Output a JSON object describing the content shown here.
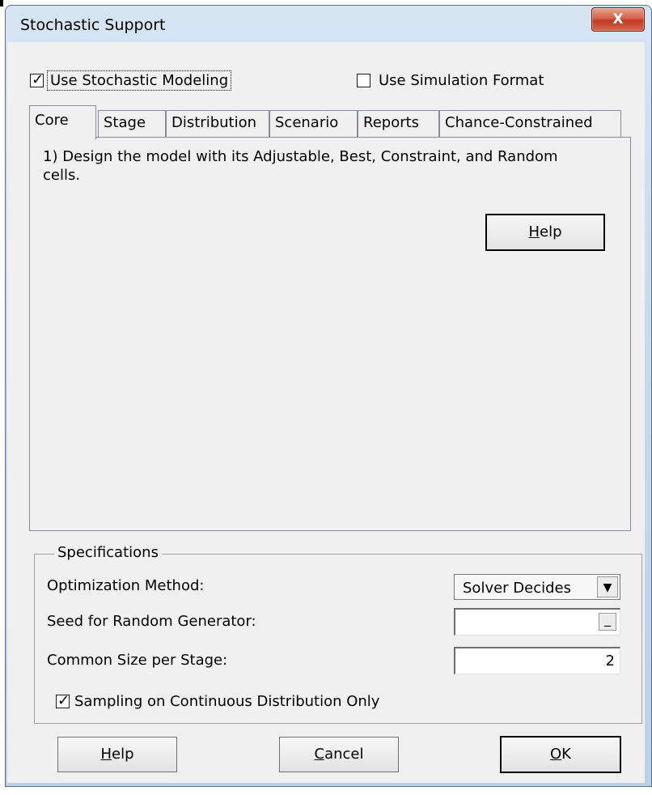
{
  "window": {
    "title": "Stochastic Support",
    "close_glyph": "X"
  },
  "options": {
    "use_stochastic_modeling": {
      "label": "Use Stochastic Modeling",
      "checked": true
    },
    "use_simulation_format": {
      "label": "Use Simulation Format",
      "checked": false
    }
  },
  "tabs": [
    {
      "label": "Core",
      "active": true
    },
    {
      "label": "Stage",
      "active": false
    },
    {
      "label": "Distribution",
      "active": false
    },
    {
      "label": "Scenario",
      "active": false
    },
    {
      "label": "Reports",
      "active": false
    },
    {
      "label": "Chance-Constrained",
      "active": false
    }
  ],
  "core_panel": {
    "instruction": "1) Design the model with its Adjustable, Best, Constraint, and Random cells.",
    "help_button": {
      "mnemonic": "H",
      "rest": "elp"
    }
  },
  "specifications": {
    "legend": "Specifications",
    "optimization_method": {
      "label": "Optimization Method:",
      "value": "Solver Decides",
      "icon": "dropdown-arrow-icon"
    },
    "seed": {
      "label": "Seed for Random Generator:",
      "value": "",
      "button_glyph": "_"
    },
    "common_size": {
      "label": "Common Size per Stage:",
      "value": "2"
    },
    "sampling": {
      "label": "Sampling on Continuous Distribution Only",
      "checked": true
    }
  },
  "footer": {
    "help": {
      "mnemonic": "H",
      "rest": "elp"
    },
    "cancel": {
      "mnemonic": "C",
      "rest": "ancel"
    },
    "ok": {
      "mnemonic": "O",
      "rest": "K"
    }
  }
}
